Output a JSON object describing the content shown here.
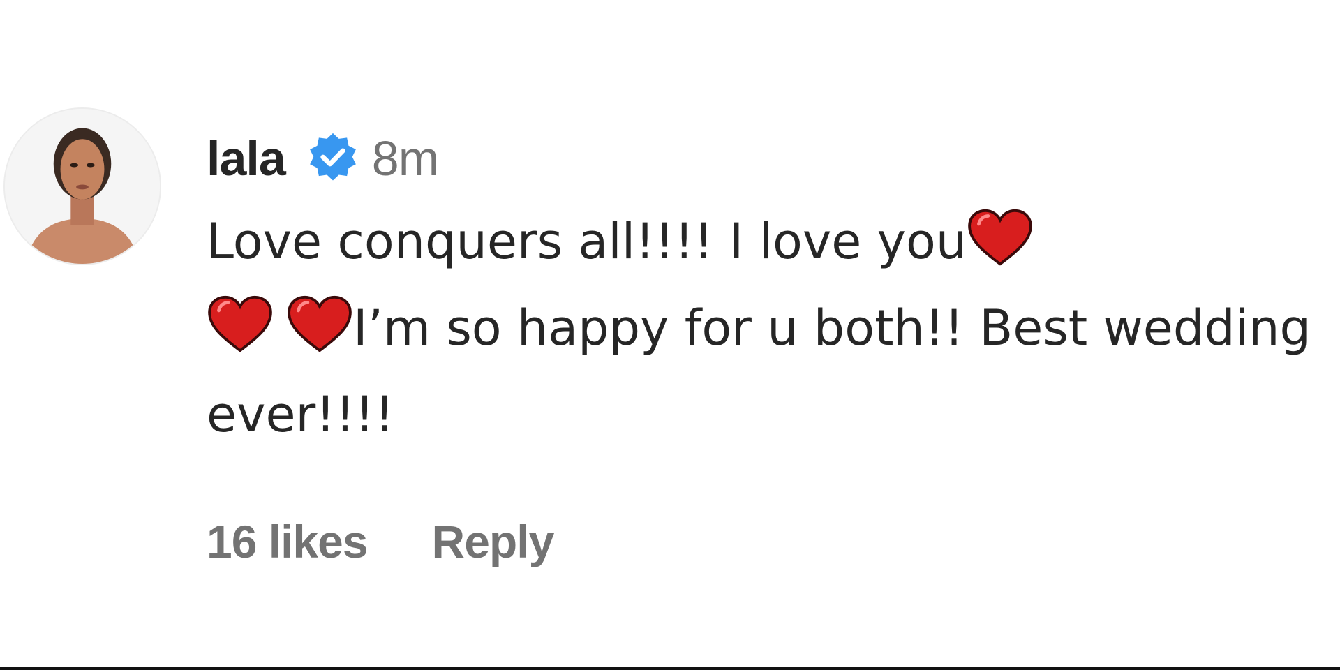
{
  "comment": {
    "username": "lala",
    "verified": true,
    "timestamp": "8m",
    "text_part1": "Love conquers all!!!! I love you",
    "text_part2": "I’m so happy for u both!! Best wedding ever!!!!",
    "emoji": "red-heart",
    "likes": "16 likes",
    "reply_label": "Reply"
  },
  "colors": {
    "verified_badge": "#3897f0",
    "heart": "#d81e1e",
    "secondary_text": "#737373",
    "primary_text": "#262626"
  }
}
